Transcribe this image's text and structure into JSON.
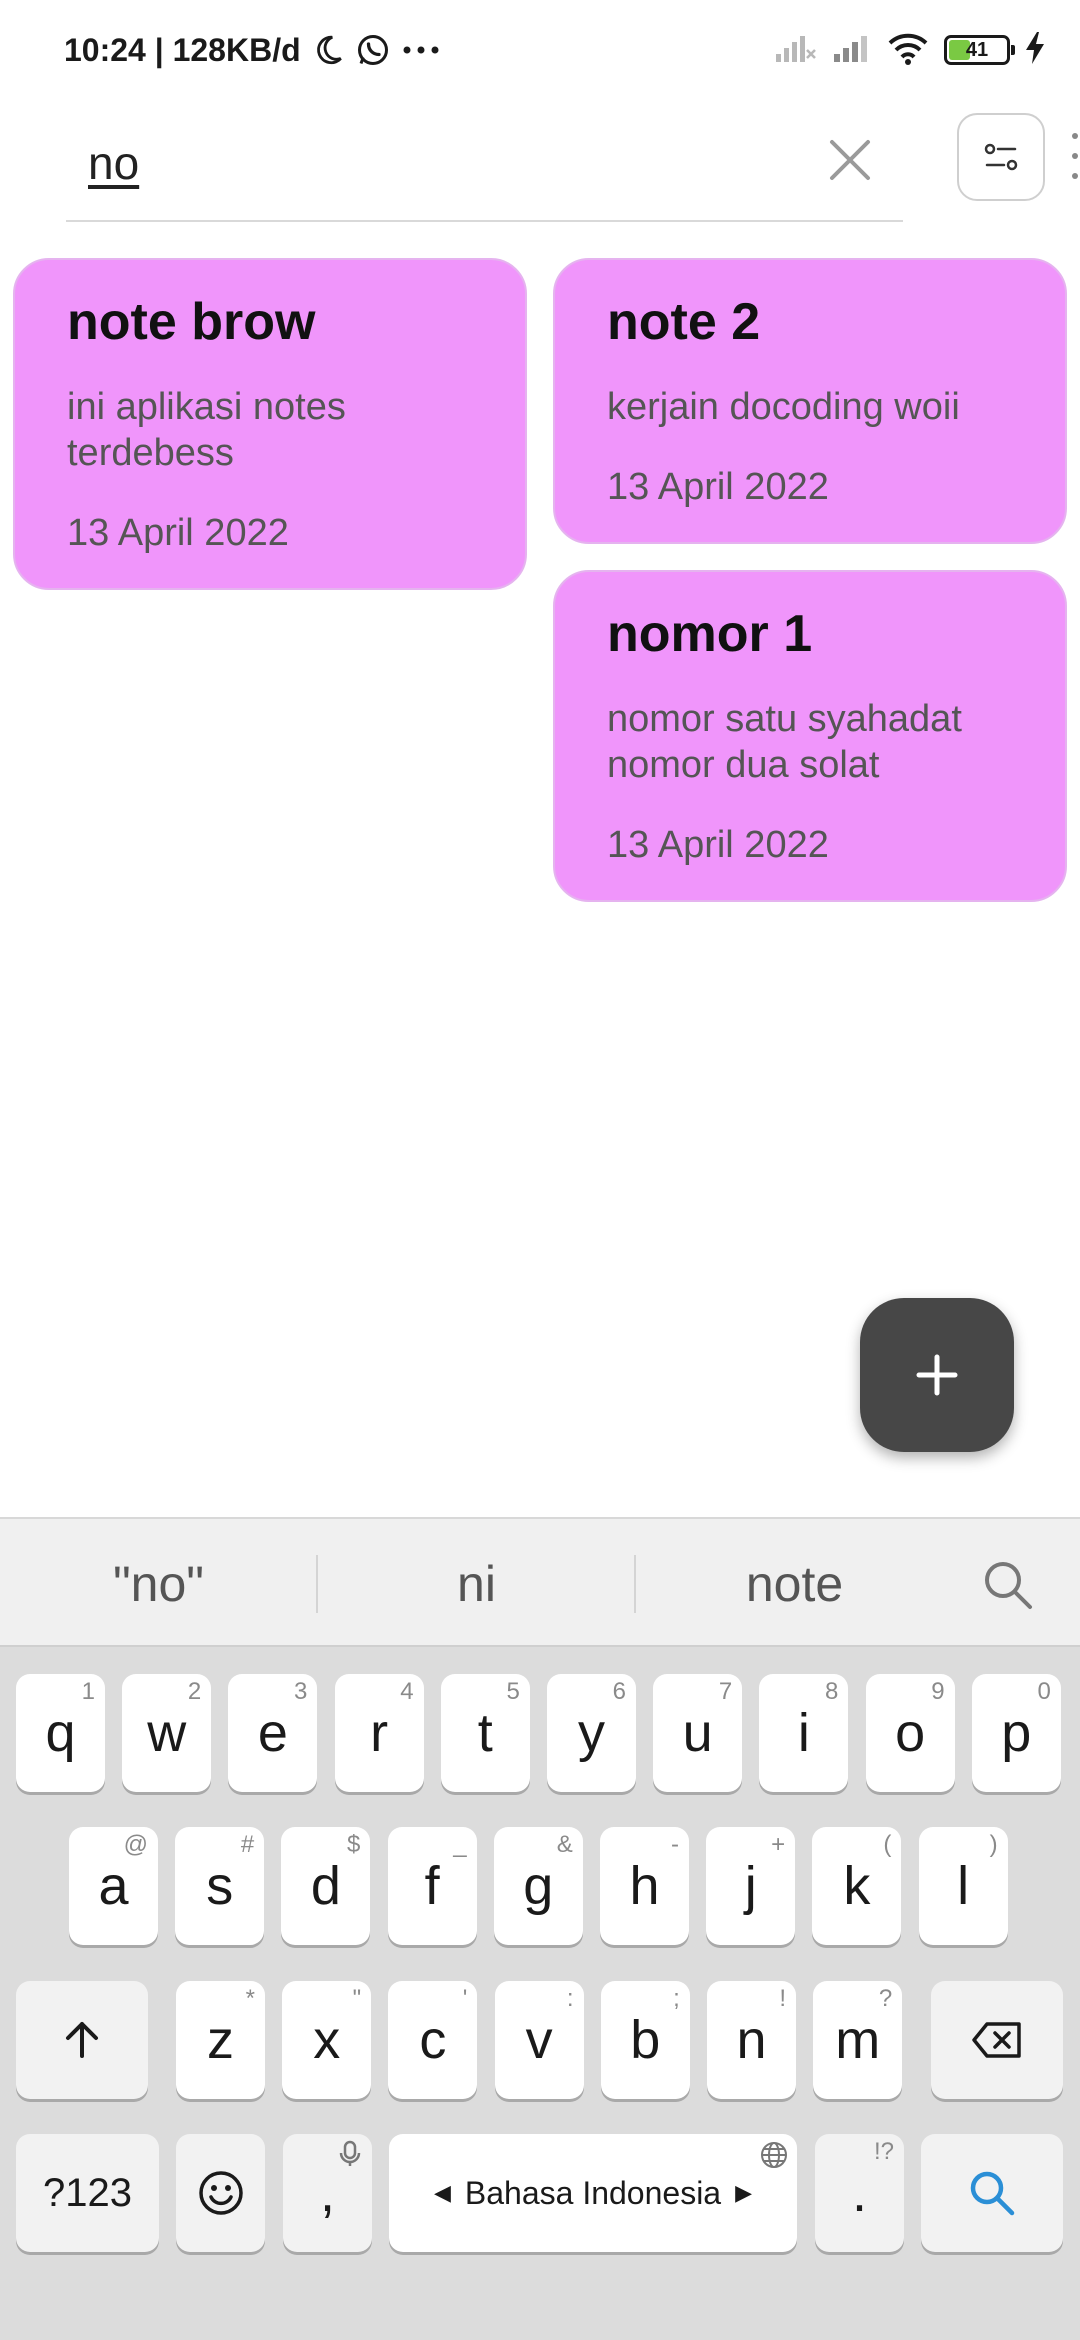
{
  "status_bar": {
    "time_speed": "10:24 | 128KB/d",
    "battery_level": "41",
    "battery_fraction": 0.41
  },
  "search": {
    "value": "no"
  },
  "notes": [
    {
      "title": "note brow",
      "body": "ini aplikasi notes terdebess",
      "date": "13 April 2022"
    },
    {
      "title": "note 2",
      "body": "kerjain docoding woii",
      "date": "13 April 2022"
    },
    {
      "title": "nomor 1",
      "body": "nomor satu syahadat nomor dua solat",
      "date": "13 April 2022"
    }
  ],
  "fab": {
    "label": "+"
  },
  "keyboard": {
    "suggestions": [
      "\"no\"",
      "ni",
      "note"
    ],
    "row1": [
      {
        "key": "q",
        "hint": "1"
      },
      {
        "key": "w",
        "hint": "2"
      },
      {
        "key": "e",
        "hint": "3"
      },
      {
        "key": "r",
        "hint": "4"
      },
      {
        "key": "t",
        "hint": "5"
      },
      {
        "key": "y",
        "hint": "6"
      },
      {
        "key": "u",
        "hint": "7"
      },
      {
        "key": "i",
        "hint": "8"
      },
      {
        "key": "o",
        "hint": "9"
      },
      {
        "key": "p",
        "hint": "0"
      }
    ],
    "row2": [
      {
        "key": "a",
        "hint": "@"
      },
      {
        "key": "s",
        "hint": "#"
      },
      {
        "key": "d",
        "hint": "$"
      },
      {
        "key": "f",
        "hint": "_"
      },
      {
        "key": "g",
        "hint": "&"
      },
      {
        "key": "h",
        "hint": "-"
      },
      {
        "key": "j",
        "hint": "+"
      },
      {
        "key": "k",
        "hint": "("
      },
      {
        "key": "l",
        "hint": ")"
      }
    ],
    "row3": [
      {
        "key": "z",
        "hint": "*"
      },
      {
        "key": "x",
        "hint": "\""
      },
      {
        "key": "c",
        "hint": "'"
      },
      {
        "key": "v",
        "hint": ":"
      },
      {
        "key": "b",
        "hint": ";"
      },
      {
        "key": "n",
        "hint": "!"
      },
      {
        "key": "m",
        "hint": "?"
      }
    ],
    "symbols_key": "?123",
    "comma_key": ",",
    "space_label": "Bahasa Indonesia",
    "period_key": ".",
    "period_hint": "!?"
  }
}
